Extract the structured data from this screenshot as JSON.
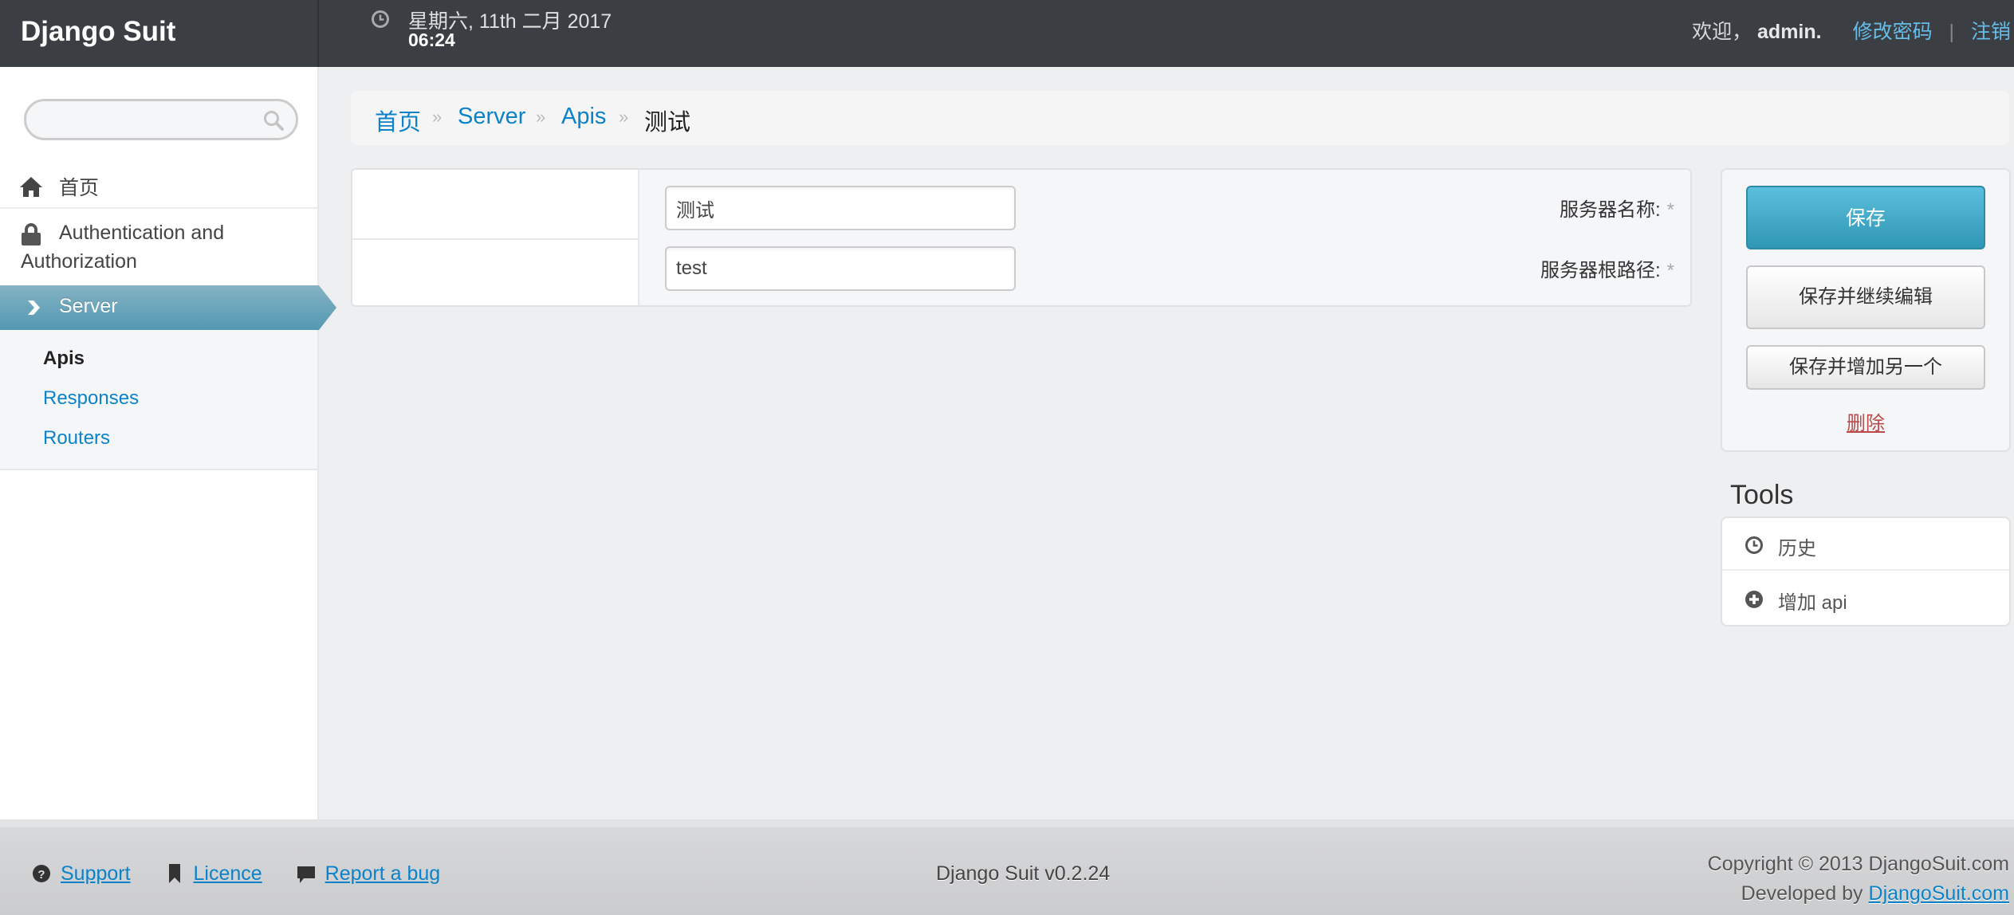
{
  "header": {
    "brand": "Django Suit",
    "date": "星期六, 11th 二月 2017",
    "time": "06:24",
    "welcome": "欢迎，",
    "username": "admin.",
    "change_password": "修改密码",
    "separator": "|",
    "logout": "注销"
  },
  "sidebar": {
    "search_placeholder": "",
    "items": [
      {
        "label": "首页",
        "icon": "home-icon"
      },
      {
        "label": "Authentication and Authorization",
        "icon": "lock-icon"
      },
      {
        "label": "Server",
        "icon": "chevron-right-icon",
        "active": true
      }
    ],
    "subitems": [
      {
        "label": "Apis",
        "active": true
      },
      {
        "label": "Responses"
      },
      {
        "label": "Routers"
      }
    ]
  },
  "breadcrumb": {
    "items": [
      "首页",
      "Server",
      "Apis"
    ],
    "divider": "»",
    "current": "测试"
  },
  "form": {
    "fields": [
      {
        "label": "服务器名称:",
        "required": "*",
        "value": "测试"
      },
      {
        "label": "服务器根路径:",
        "required": "*",
        "value": "test"
      }
    ]
  },
  "submit": {
    "save": "保存",
    "save_continue": "保存并继续编辑",
    "save_add_another": "保存并增加另一个",
    "delete": "删除"
  },
  "tools": {
    "title": "Tools",
    "items": [
      {
        "label": "历史",
        "icon": "clock-icon"
      },
      {
        "label": "增加 api",
        "icon": "plus-circle-icon"
      }
    ]
  },
  "footer": {
    "links": [
      "Support",
      "Licence",
      "Report a bug"
    ],
    "version": "Django Suit v0.2.24",
    "copyright": "Copyright © 2013 DjangoSuit.com",
    "developed_by": "Developed by",
    "developer_link": "DjangoSuit.com"
  },
  "colors": {
    "header_bg": "#3b3e42",
    "link": "#0c82c8",
    "header_link": "#66bde9",
    "primary_button": "#49afcd",
    "active_nav": "#6aa6bd",
    "delete": "#b94a48"
  }
}
